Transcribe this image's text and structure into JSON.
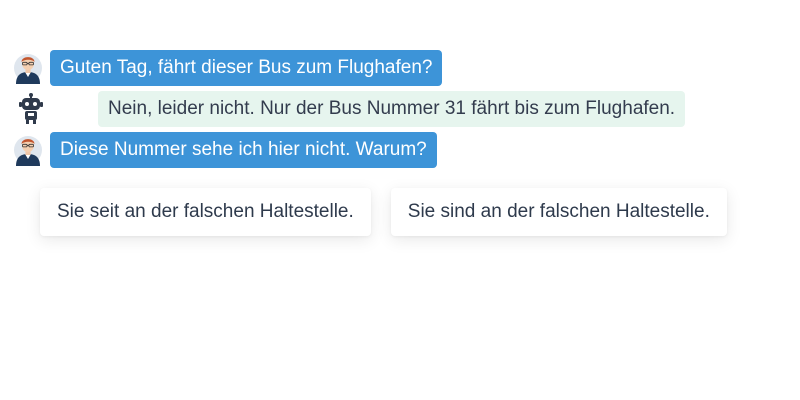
{
  "messages": [
    {
      "sender": "user",
      "avatar_icon": "user-avatar-icon",
      "text": "Guten Tag, fährt dieser Bus zum Flughafen?"
    },
    {
      "sender": "bot",
      "avatar_icon": "robot-icon",
      "text": "Nein, leider nicht. Nur der Bus Nummer 31 fährt bis zum Flughafen."
    },
    {
      "sender": "user",
      "avatar_icon": "user-avatar-icon",
      "text": "Diese Nummer sehe ich hier nicht. Warum?"
    }
  ],
  "options": [
    {
      "label": "Sie seit an der falschen Haltestelle."
    },
    {
      "label": "Sie sind an der falschen Haltestelle."
    }
  ],
  "colors": {
    "user_bubble": "#3d94d8",
    "bot_bubble": "#e6f5ee",
    "text_dark": "#333c4e"
  }
}
